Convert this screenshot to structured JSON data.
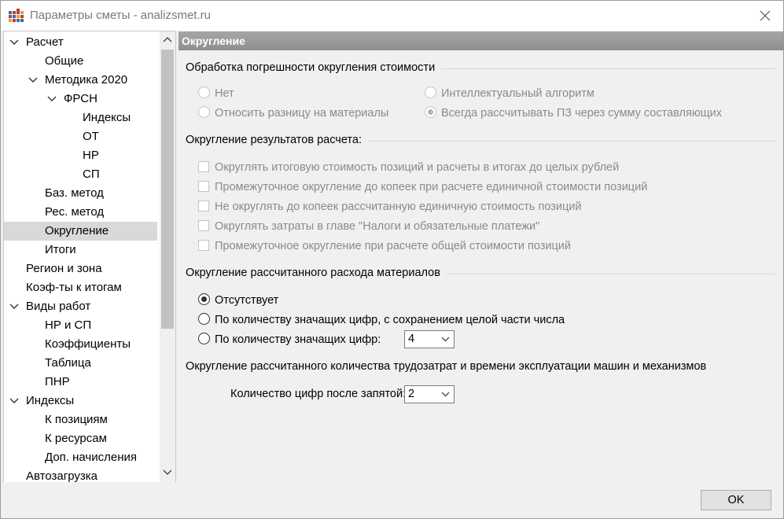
{
  "window": {
    "title": "Параметры сметы - analizsmet.ru"
  },
  "tree": [
    {
      "label": "Расчет",
      "level": 0,
      "expanded": true
    },
    {
      "label": "Общие",
      "level": 1
    },
    {
      "label": "Методика 2020",
      "level": 1,
      "expanded": true
    },
    {
      "label": "ФРСН",
      "level": 2,
      "expanded": true
    },
    {
      "label": "Индексы",
      "level": 3
    },
    {
      "label": "ОТ",
      "level": 3
    },
    {
      "label": "НР",
      "level": 3
    },
    {
      "label": "СП",
      "level": 3
    },
    {
      "label": "Баз. метод",
      "level": 1
    },
    {
      "label": "Рес. метод",
      "level": 1
    },
    {
      "label": "Округление",
      "level": 1,
      "selected": true
    },
    {
      "label": "Итоги",
      "level": 1
    },
    {
      "label": "Регион и зона",
      "level": 0
    },
    {
      "label": "Коэф-ты к итогам",
      "level": 0
    },
    {
      "label": "Виды работ",
      "level": 0,
      "expanded": true
    },
    {
      "label": "НР и СП",
      "level": 1
    },
    {
      "label": "Коэффициенты",
      "level": 1
    },
    {
      "label": "Таблица",
      "level": 1
    },
    {
      "label": "ПНР",
      "level": 1
    },
    {
      "label": "Индексы",
      "level": 0,
      "expanded": true
    },
    {
      "label": "К позициям",
      "level": 1
    },
    {
      "label": "К ресурсам",
      "level": 1
    },
    {
      "label": "Доп. начисления",
      "level": 1
    },
    {
      "label": "Автозагрузка",
      "level": 0
    }
  ],
  "content": {
    "header": "Округление",
    "group1": {
      "title": "Обработка погрешности округления стоимости",
      "options": {
        "net": "Нет",
        "materials": "Относить разницу на материалы",
        "intellect": "Интеллектуальный алгоритм",
        "always": "Всегда рассчитывать ПЗ через сумму составляющих"
      }
    },
    "group2": {
      "title": "Округление результатов расчета:",
      "checks": [
        "Округлять итоговую стоимость позиций и расчеты в итогах до целых рублей",
        "Промежуточное округление до копеек при расчете единичной стоимости позиций",
        "Не округлять до копеек рассчитанную единичную стоимость позиций",
        "Округлять затраты в главе \"Налоги и обязательные платежи\"",
        "Промежуточное округление при расчете общей стоимости позиций"
      ]
    },
    "group3": {
      "title": "Округление рассчитанного расхода материалов",
      "options": {
        "none": "Отсутствует",
        "keep_int": "По количеству значащих цифр, с сохранением целой части числа",
        "sig": "По количеству значащих цифр:"
      },
      "sig_value": "4"
    },
    "group4": {
      "title": "Округление рассчитанного количества трудозатрат и времени эксплуатации машин и механизмов",
      "label": "Количество цифр после запятой:",
      "value": "2"
    }
  },
  "buttons": {
    "ok": "OK"
  }
}
